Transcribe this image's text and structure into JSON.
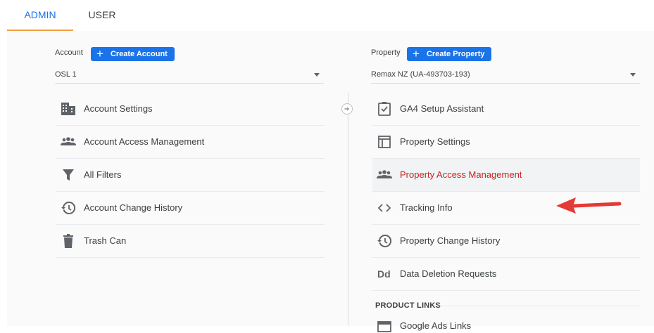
{
  "tabs": [
    {
      "label": "ADMIN",
      "active": true
    },
    {
      "label": "USER",
      "active": false
    }
  ],
  "account": {
    "label": "Account",
    "create_label": "Create Account",
    "selected": "OSL 1",
    "items": [
      {
        "label": "Account Settings",
        "icon": "building-icon"
      },
      {
        "label": "Account Access Management",
        "icon": "people-icon"
      },
      {
        "label": "All Filters",
        "icon": "filter-icon"
      },
      {
        "label": "Account Change History",
        "icon": "history-icon"
      },
      {
        "label": "Trash Can",
        "icon": "trash-icon"
      }
    ]
  },
  "property": {
    "label": "Property",
    "create_label": "Create Property",
    "selected": "Remax NZ (UA-493703-193)",
    "items": [
      {
        "label": "GA4 Setup Assistant",
        "icon": "clipboard-check-icon"
      },
      {
        "label": "Property Settings",
        "icon": "layout-icon"
      },
      {
        "label": "Property Access Management",
        "icon": "people-icon",
        "active": true
      },
      {
        "label": "Tracking Info",
        "icon": "code-icon"
      },
      {
        "label": "Property Change History",
        "icon": "history-icon"
      },
      {
        "label": "Data Deletion Requests",
        "icon": "dd-icon"
      }
    ],
    "section_heading": "PRODUCT LINKS",
    "section_next_item": "Google Ads Links"
  },
  "colors": {
    "accent": "#1a73e8",
    "tab_underline": "#f4a040",
    "active_text": "#c5221f",
    "annotation_arrow": "#e53935"
  }
}
